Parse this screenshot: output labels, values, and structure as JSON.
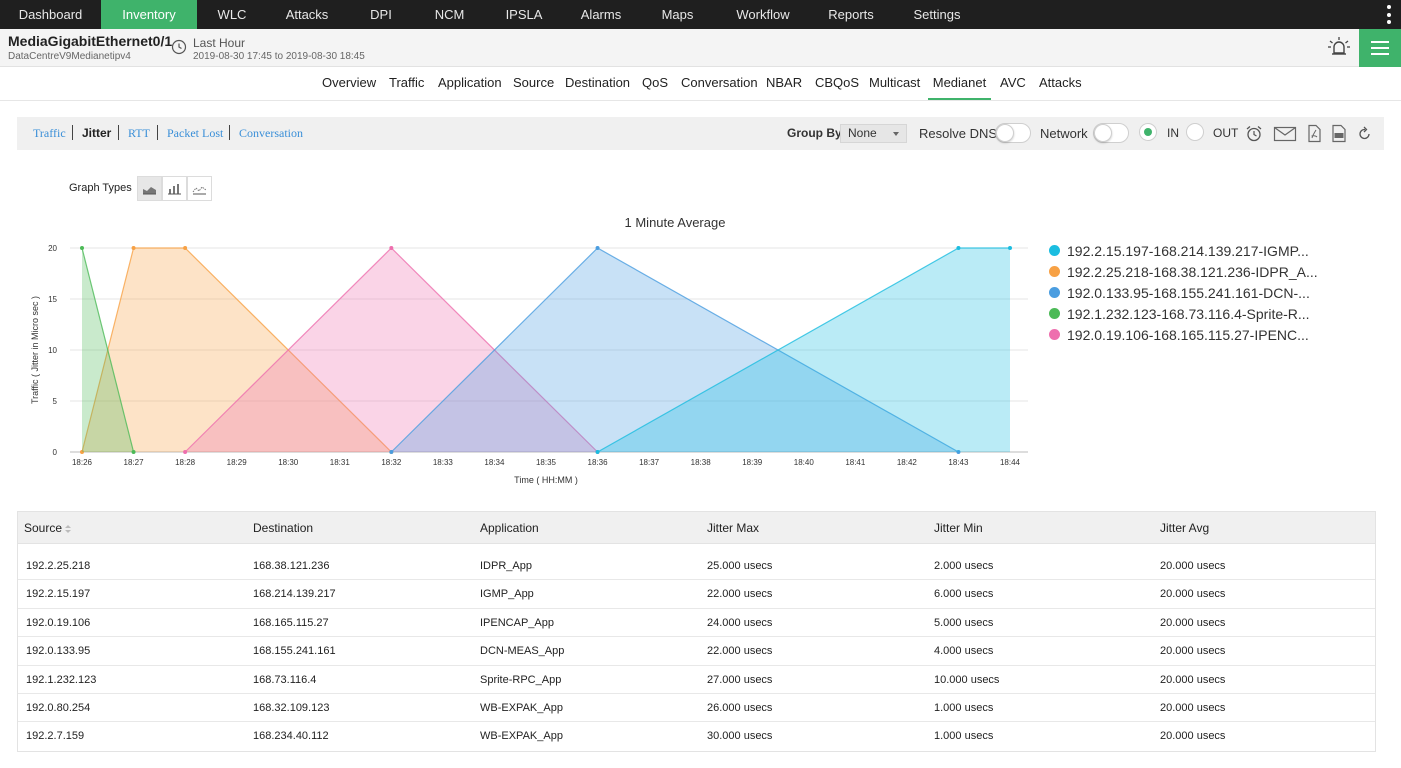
{
  "topnav": {
    "items": [
      "Dashboard",
      "Inventory",
      "WLC",
      "Attacks",
      "DPI",
      "NCM",
      "IPSLA",
      "Alarms",
      "Maps",
      "Workflow",
      "Reports",
      "Settings"
    ],
    "active": "Inventory"
  },
  "device": {
    "name": "MediaGigabitEthernet0/1",
    "subtitle": "DataCentreV9Medianetipv4",
    "period": "Last Hour",
    "range": "2019-08-30 17:45 to 2019-08-30 18:45"
  },
  "subtabs": {
    "items": [
      "Overview",
      "Traffic",
      "Application",
      "Source",
      "Destination",
      "QoS",
      "Conversation",
      "NBAR",
      "CBQoS",
      "Multicast",
      "Medianet",
      "AVC",
      "Attacks"
    ],
    "active": "Medianet"
  },
  "toolbar": {
    "links": [
      "Traffic",
      "Jitter",
      "RTT",
      "Packet Lost",
      "Conversation"
    ],
    "active_link": "Jitter",
    "group_by_label": "Group By",
    "group_by_value": "None",
    "resolve_dns_label": "Resolve DNS",
    "network_label": "Network",
    "in_label": "IN",
    "out_label": "OUT",
    "direction": "IN"
  },
  "graph_types": {
    "label": "Graph Types",
    "options": [
      "area-chart-icon",
      "bar-chart-icon",
      "line-chart-icon"
    ],
    "active": "area-chart-icon"
  },
  "chart_data": {
    "type": "area",
    "title": "1 Minute Average",
    "xlabel": "Time ( HH:MM )",
    "ylabel": "Traffic ( Jitter in Micro sec )",
    "ylim": [
      0,
      20
    ],
    "yticks": [
      0,
      5,
      10,
      15,
      20
    ],
    "x": [
      "18:26",
      "18:27",
      "18:28",
      "18:29",
      "18:30",
      "18:31",
      "18:32",
      "18:33",
      "18:34",
      "18:35",
      "18:36",
      "18:37",
      "18:38",
      "18:39",
      "18:40",
      "18:41",
      "18:42",
      "18:43",
      "18:44"
    ],
    "legend_position": "right",
    "grid": true,
    "series": [
      {
        "name": "192.2.15.197-168.214.139.217-IGMP...",
        "color": "#1bbde0",
        "points": [
          [
            "18:36",
            0
          ],
          [
            "18:43",
            20
          ],
          [
            "18:44",
            20
          ]
        ]
      },
      {
        "name": "192.2.25.218-168.38.121.236-IDPR_A...",
        "color": "#f7a145",
        "points": [
          [
            "18:26",
            0
          ],
          [
            "18:27",
            20
          ],
          [
            "18:28",
            20
          ],
          [
            "18:32",
            0
          ]
        ]
      },
      {
        "name": "192.0.133.95-168.155.241.161-DCN-...",
        "color": "#4a9de0",
        "points": [
          [
            "18:32",
            0
          ],
          [
            "18:36",
            20
          ],
          [
            "18:43",
            0
          ]
        ]
      },
      {
        "name": "192.1.232.123-168.73.116.4-Sprite-R...",
        "color": "#4cba57",
        "points": [
          [
            "18:26",
            20
          ],
          [
            "18:27",
            0
          ]
        ]
      },
      {
        "name": "192.0.19.106-168.165.115.27-IPENC...",
        "color": "#ee6fae",
        "points": [
          [
            "18:28",
            0
          ],
          [
            "18:32",
            20
          ],
          [
            "18:36",
            0
          ]
        ]
      }
    ]
  },
  "table": {
    "columns": [
      "Source",
      "Destination",
      "Application",
      "Jitter Max",
      "Jitter Min",
      "Jitter Avg"
    ],
    "rows": [
      [
        "192.2.25.218",
        "168.38.121.236",
        "IDPR_App",
        "25.000 usecs",
        "2.000 usecs",
        "20.000 usecs"
      ],
      [
        "192.2.15.197",
        "168.214.139.217",
        "IGMP_App",
        "22.000 usecs",
        "6.000 usecs",
        "20.000 usecs"
      ],
      [
        "192.0.19.106",
        "168.165.115.27",
        "IPENCAP_App",
        "24.000 usecs",
        "5.000 usecs",
        "20.000 usecs"
      ],
      [
        "192.0.133.95",
        "168.155.241.161",
        "DCN-MEAS_App",
        "22.000 usecs",
        "4.000 usecs",
        "20.000 usecs"
      ],
      [
        "192.1.232.123",
        "168.73.116.4",
        "Sprite-RPC_App",
        "27.000 usecs",
        "10.000 usecs",
        "20.000 usecs"
      ],
      [
        "192.0.80.254",
        "168.32.109.123",
        "WB-EXPAK_App",
        "26.000 usecs",
        "1.000 usecs",
        "20.000 usecs"
      ],
      [
        "192.2.7.159",
        "168.234.40.112",
        "WB-EXPAK_App",
        "30.000 usecs",
        "1.000 usecs",
        "20.000 usecs"
      ]
    ]
  }
}
